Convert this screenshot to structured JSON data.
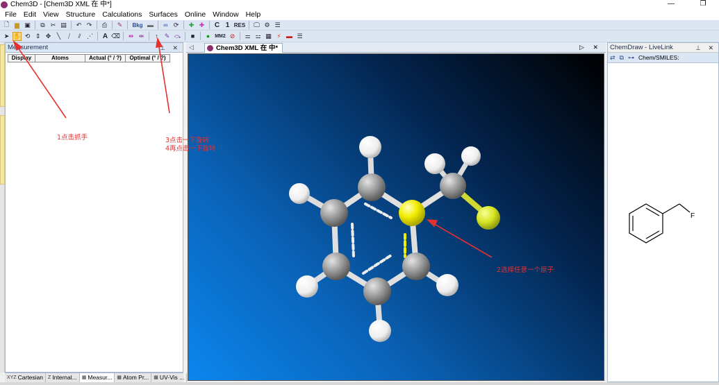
{
  "window": {
    "title": "Chem3D - [Chem3D XML 在 中*]",
    "minimize": "—",
    "restore": "❐"
  },
  "menu": [
    "File",
    "Edit",
    "View",
    "Structure",
    "Calculations",
    "Surfaces",
    "Online",
    "Window",
    "Help"
  ],
  "toolbar": {
    "bkg_label": "Bkg",
    "mm2_label": "MM2",
    "c_label": "C",
    "one_label": "1",
    "res_label": "RES",
    "text_tool": "A"
  },
  "measurement": {
    "title": "Measurement",
    "columns": [
      "Display",
      "Atoms",
      "Actual (° / ?)",
      "Optimal (° / ?)"
    ]
  },
  "document": {
    "tab_title": "Chem3D XML 在 中*"
  },
  "chemdraw": {
    "title": "ChemDraw - LiveLink",
    "smiles_label": "Chem/SMILES:",
    "atom_label": "F"
  },
  "bottom_tabs": [
    {
      "icon": "XYZ",
      "label": "Cartesian"
    },
    {
      "icon": "Z",
      "label": "Internal..."
    },
    {
      "icon": "▦",
      "label": "Measur..."
    },
    {
      "icon": "▦",
      "label": "Atom Pr..."
    },
    {
      "icon": "▦",
      "label": "UV-Vis ..."
    }
  ],
  "annotations": {
    "step1": "1点击抓手",
    "step2": "2选择任意一个原子",
    "step3": "3点击一下旋转",
    "step4": "4再点击一下旋转"
  },
  "colors": {
    "carbon": "#9a9a9a",
    "hydrogen": "#f4f4f4",
    "selected_atom": "#f2ee00",
    "fluorine": "#d8e624",
    "annotation": "#e53030"
  }
}
